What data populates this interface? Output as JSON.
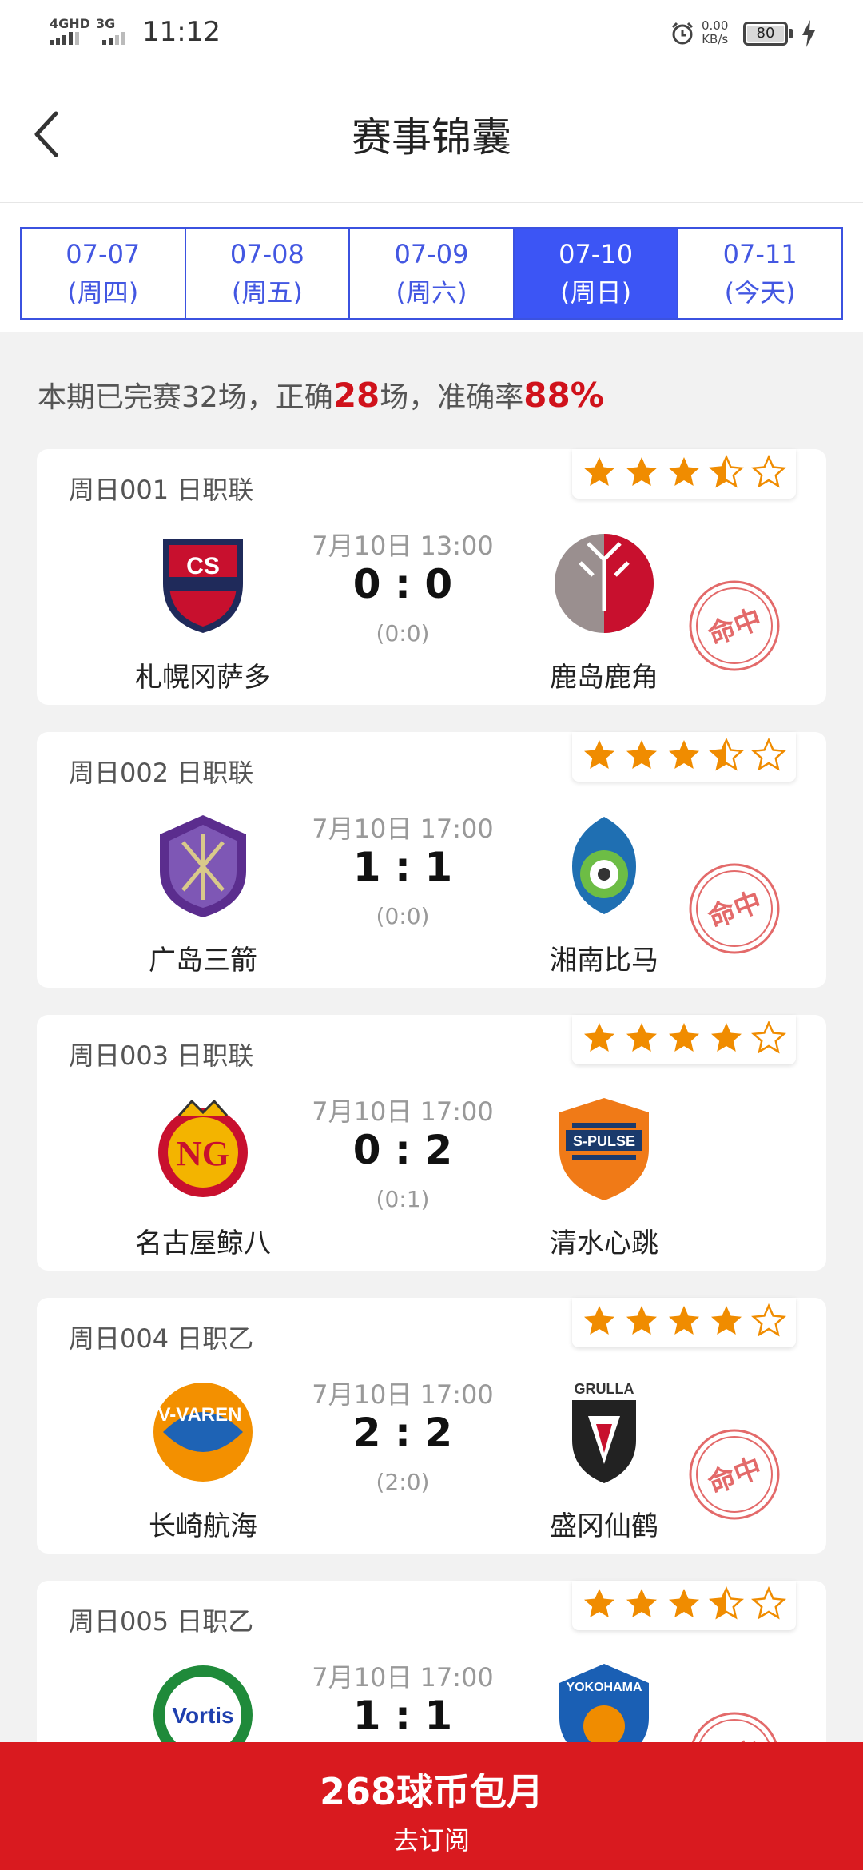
{
  "status_bar": {
    "network1": "4GHD",
    "network2": "3G",
    "time": "11:12",
    "speed_value": "0.00",
    "speed_unit": "KB/s",
    "battery": "80"
  },
  "header": {
    "title": "赛事锦囊"
  },
  "date_tabs": [
    {
      "date": "07-07",
      "day": "(周四)"
    },
    {
      "date": "07-08",
      "day": "(周五)"
    },
    {
      "date": "07-09",
      "day": "(周六)"
    },
    {
      "date": "07-10",
      "day": "(周日)",
      "active": true
    },
    {
      "date": "07-11",
      "day": "(今天)"
    }
  ],
  "summary": {
    "p1": "本期已完赛32场，正确",
    "correct": "28",
    "p2": "场，准确率",
    "rate": "88%"
  },
  "matches": [
    {
      "code": "周日001 日职联",
      "rating": 3.5,
      "time": "7月10日 13:00",
      "score": "0 : 0",
      "half": "(0:0)",
      "home": "札幌冈萨多",
      "away": "鹿岛鹿角",
      "hit": true,
      "stamp_text": "命中"
    },
    {
      "code": "周日002 日职联",
      "rating": 3.5,
      "time": "7月10日 17:00",
      "score": "1 : 1",
      "half": "(0:0)",
      "home": "广岛三箭",
      "away": "湘南比马",
      "hit": true,
      "stamp_text": "命中"
    },
    {
      "code": "周日003 日职联",
      "rating": 4,
      "time": "7月10日 17:00",
      "score": "0 : 2",
      "half": "(0:1)",
      "home": "名古屋鲸八",
      "away": "清水心跳",
      "hit": false
    },
    {
      "code": "周日004 日职乙",
      "rating": 4,
      "time": "7月10日 17:00",
      "score": "2 : 2",
      "half": "(2:0)",
      "home": "长崎航海",
      "away": "盛冈仙鹤",
      "hit": true,
      "stamp_text": "命中"
    },
    {
      "code": "周日005 日职乙",
      "rating": 3.5,
      "time": "7月10日 17:00",
      "score": "1 : 1",
      "half": "",
      "home": "",
      "away": "",
      "hit": true,
      "stamp_text": "命中"
    }
  ],
  "subscribe": {
    "title": "268球币包月",
    "action": "去订阅"
  },
  "colors": {
    "accent_blue": "#3c55f5",
    "red": "#d91a1f",
    "star_orange": "#f08c00"
  }
}
